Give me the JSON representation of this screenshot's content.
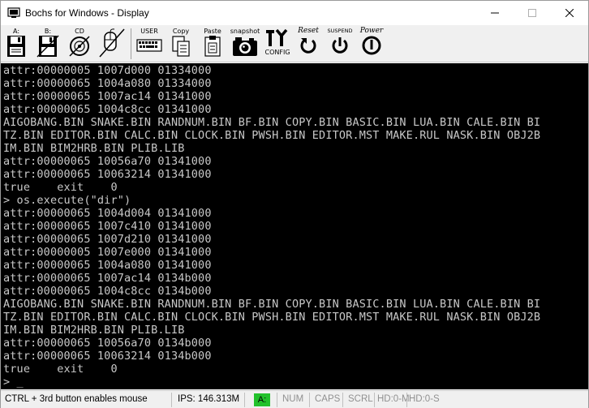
{
  "window": {
    "title": "Bochs for Windows - Display"
  },
  "toolbar": {
    "buttons": [
      {
        "label": "A:",
        "icon": "floppy-a-icon"
      },
      {
        "label": "B:",
        "icon": "floppy-b-icon"
      },
      {
        "label": "CD",
        "icon": "cdrom-icon"
      },
      {
        "label": "",
        "icon": "mouse-icon"
      },
      {
        "label": "USER",
        "icon": "user-keyboard-icon"
      },
      {
        "label": "Copy",
        "icon": "copy-icon"
      },
      {
        "label": "Paste",
        "icon": "paste-icon"
      },
      {
        "label": "snapshot",
        "icon": "camera-icon"
      },
      {
        "label": "CONFIG",
        "icon": "config-icon"
      },
      {
        "label": "Reset",
        "icon": "reset-icon"
      },
      {
        "label": "SUSPEND",
        "icon": "suspend-icon"
      },
      {
        "label": "Power",
        "icon": "power-icon"
      }
    ]
  },
  "console": {
    "lines": [
      "attr:00000005 1007d000 01334000",
      "attr:00000065 1004a080 01334000",
      "attr:00000065 1007ac14 01341000",
      "attr:00000065 1004c8cc 01341000",
      "AIGOBANG.BIN SNAKE.BIN RANDNUM.BIN BF.BIN COPY.BIN BASIC.BIN LUA.BIN CALE.BIN BI",
      "TZ.BIN EDITOR.BIN CALC.BIN CLOCK.BIN PWSH.BIN EDITOR.MST MAKE.RUL NASK.BIN OBJ2B",
      "IM.BIN BIM2HRB.BIN PLIB.LIB",
      "attr:00000065 10056a70 01341000",
      "attr:00000065 10063214 01341000",
      "true    exit    0",
      "> os.execute(\"dir\")",
      "attr:00000065 1004d004 01341000",
      "attr:00000065 1007c410 01341000",
      "attr:00000065 1007d210 01341000",
      "attr:00000005 1007e000 01341000",
      "attr:00000065 1004a080 01341000",
      "attr:00000065 1007ac14 0134b000",
      "attr:00000065 1004c8cc 0134b000",
      "AIGOBANG.BIN SNAKE.BIN RANDNUM.BIN BF.BIN COPY.BIN BASIC.BIN LUA.BIN CALE.BIN BI",
      "TZ.BIN EDITOR.BIN CALC.BIN CLOCK.BIN PWSH.BIN EDITOR.MST MAKE.RUL NASK.BIN OBJ2B",
      "IM.BIN BIM2HRB.BIN PLIB.LIB",
      "attr:00000065 10056a70 0134b000",
      "attr:00000065 10063214 0134b000",
      "true    exit    0",
      "> _"
    ]
  },
  "status": {
    "hint": "CTRL + 3rd button enables mouse",
    "ips": "IPS: 146.313M",
    "drive_led": "A:",
    "num": "NUM",
    "caps": "CAPS",
    "scrl": "SCRL",
    "hd0m": "HD:0-M",
    "hd0s": "HD:0-S",
    "led_color": "#22c12b"
  },
  "colors": {
    "console_bg": "#000000",
    "console_fg": "#c8c8c8"
  }
}
